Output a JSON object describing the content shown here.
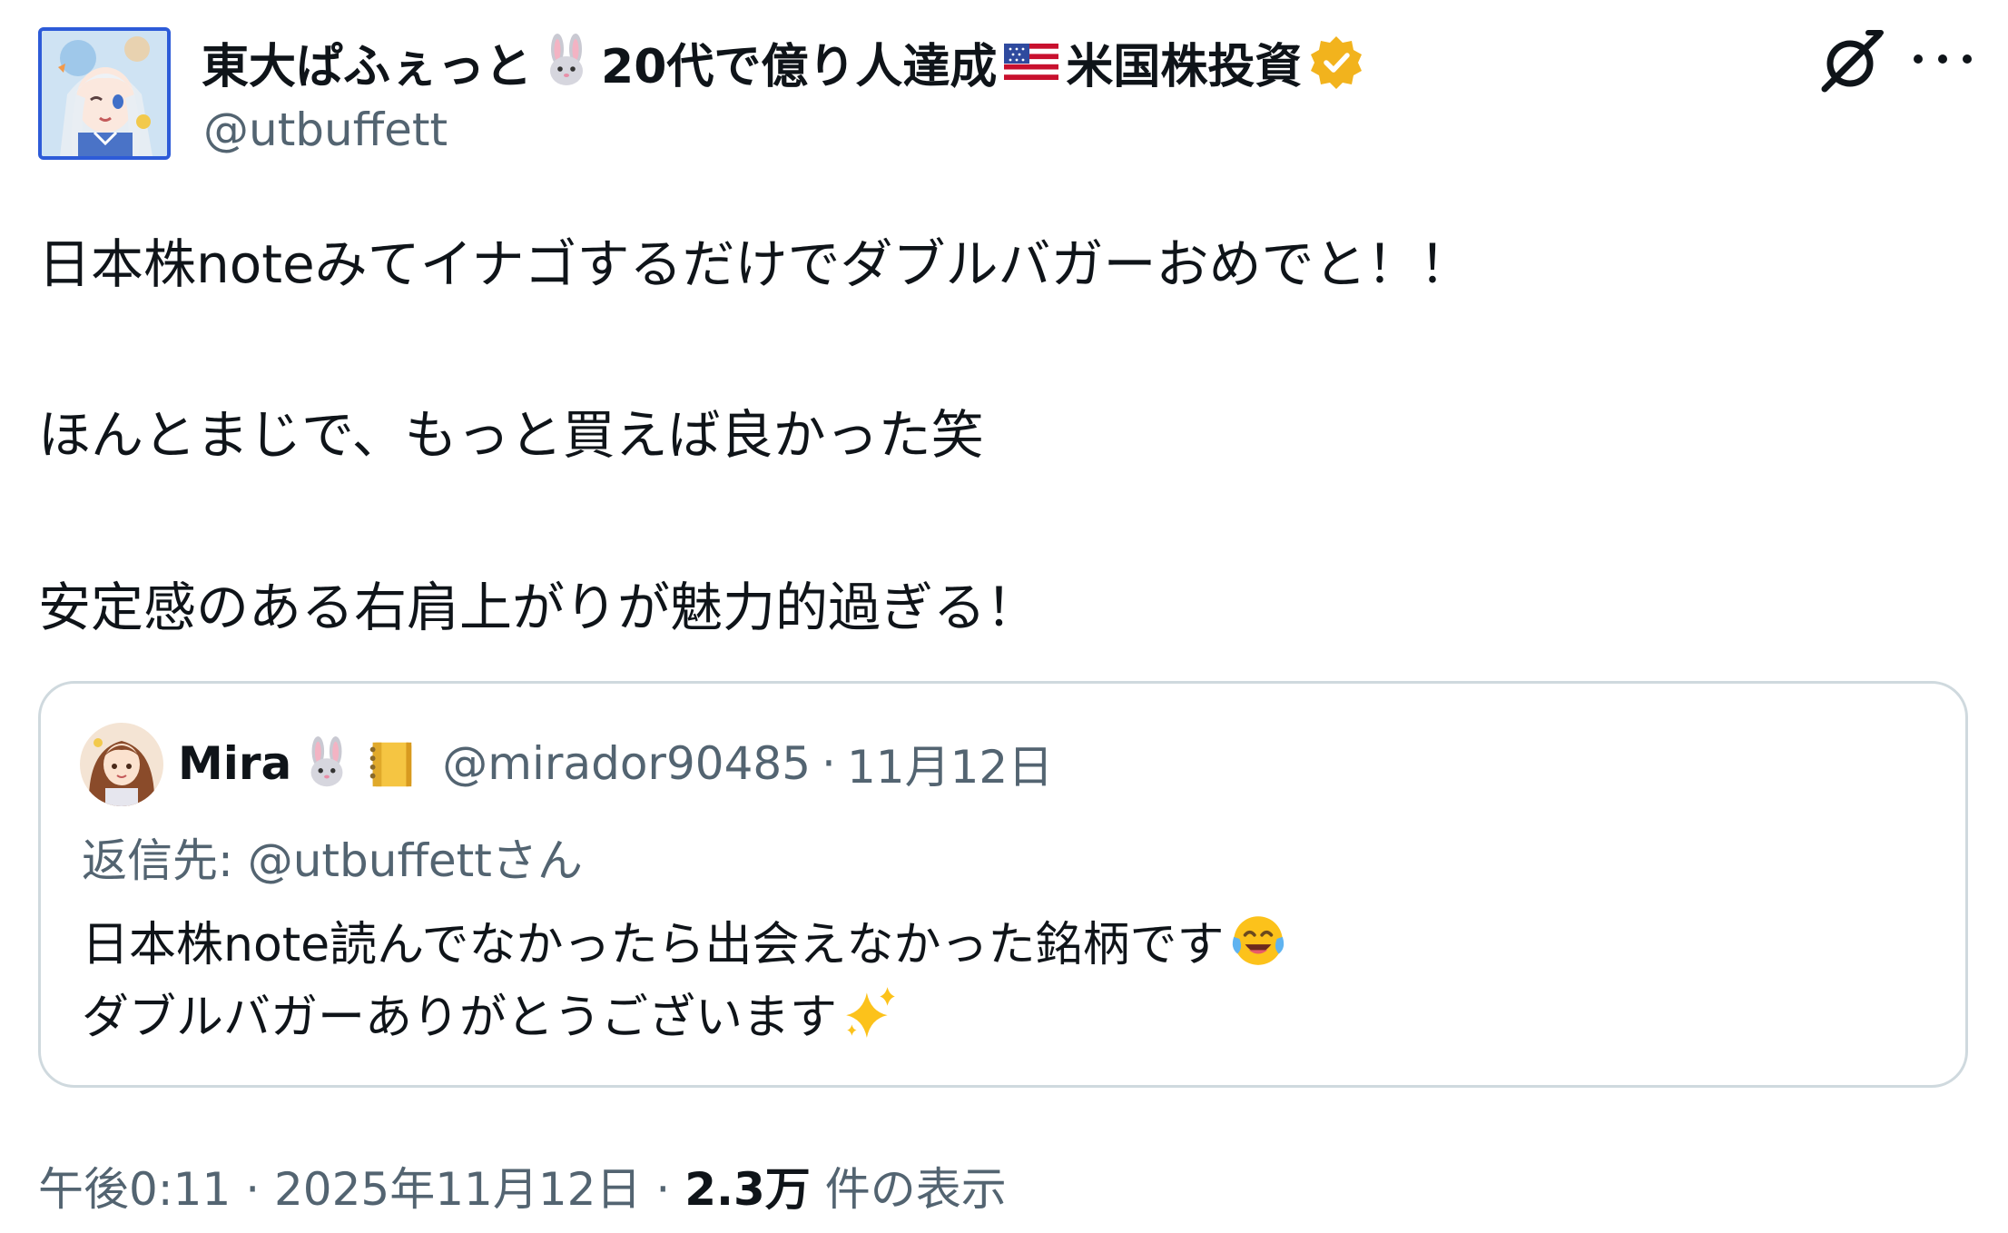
{
  "author": {
    "name_parts": [
      "東大ぱふぇっと",
      "20代で億り人達成",
      "米国株投資"
    ],
    "name_emojis": [
      "rabbit-face-emoji",
      "us-flag-emoji"
    ],
    "verified_badge": "verified-badge-gold",
    "handle": "@utbuffett",
    "avatar": "anime-girl-avatar",
    "badge_color": "#f2b31d",
    "avatar_border_color": "#2d5bd8"
  },
  "header_actions": {
    "grok": "grok-icon",
    "more": "more-icon"
  },
  "tweet": {
    "lines": [
      "日本株noteみてイナゴするだけでダブルバガーおめでと！！",
      "ほんとまじで、もっと買えば良かった笑",
      "安定感のある右肩上がりが魅力的過ぎる！"
    ]
  },
  "quote": {
    "name": "Mira",
    "name_emojis": [
      "rabbit-face-emoji",
      "notebook-emoji"
    ],
    "handle": "@mirador90485",
    "separator": "·",
    "date": "11月12日",
    "reply_to": "返信先: @utbuffettさん",
    "text_line1": "日本株note読んでなかったら出会えなかった銘柄です",
    "text_line1_emoji": "tears-of-joy-emoji",
    "text_line2": "ダブルバガーありがとうございます",
    "text_line2_emoji": "sparkles-emoji",
    "border_color": "#cfd9de"
  },
  "footer": {
    "time": "午後0:11",
    "sep1": "·",
    "date": "2025年11月12日",
    "sep2": "·",
    "views_count": "2.3万",
    "views_label": "件の表示"
  },
  "colors": {
    "text_primary": "#0f1419",
    "text_secondary": "#536471"
  }
}
